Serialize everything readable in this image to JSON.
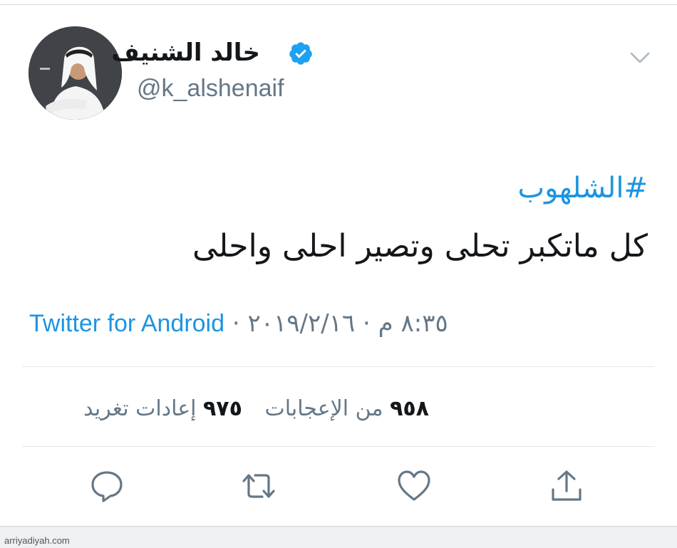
{
  "tweet": {
    "author": {
      "display_name": "خالد الشنيف",
      "handle": "@k_alshenaif",
      "verified": true
    },
    "hashtag": "#الشلهوب",
    "text": "كل ماتكبر تحلى وتصير احلى واحلى",
    "timestamp": "٨:٣٥ م · ٢٠١٩/٢/١٦",
    "separator": "·",
    "source": "Twitter for Android",
    "stats": {
      "likes_count": "٩٥٨",
      "likes_label": "من الإعجابات",
      "retweets_count": "٩٧٥",
      "retweets_label": "إعادات تغريد"
    }
  },
  "icons": {
    "menu": "chevron-down-icon",
    "verified": "verified-badge-icon",
    "reply": "reply-icon",
    "retweet": "retweet-icon",
    "like": "heart-icon",
    "share": "share-icon"
  },
  "colors": {
    "accent": "#1b95e0",
    "secondary_text": "#657786",
    "divider": "#e1e8ed"
  },
  "watermark": "arriyadiyah.com"
}
